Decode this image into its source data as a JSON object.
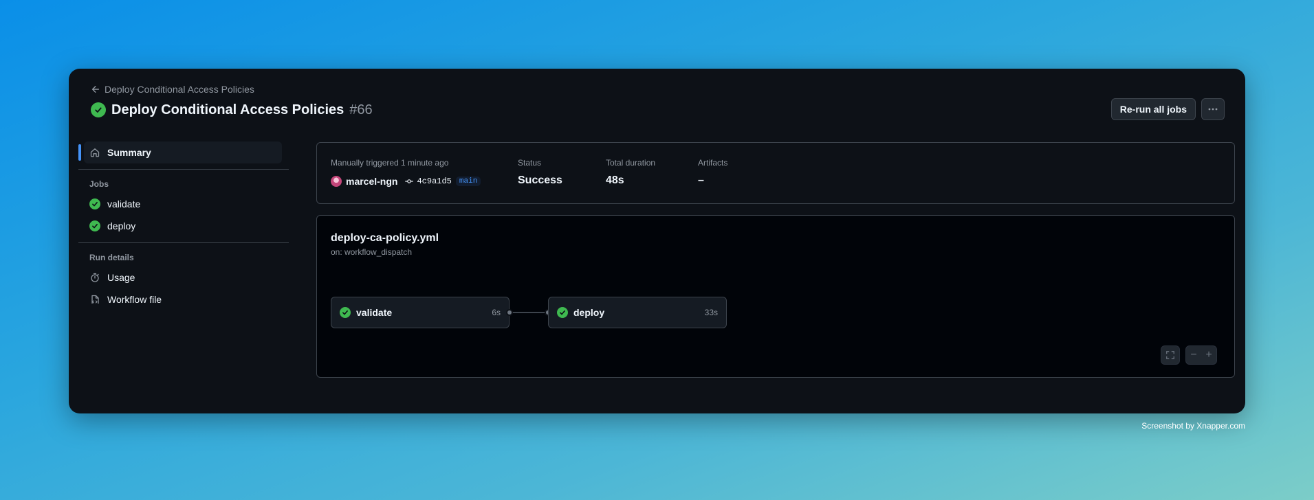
{
  "header": {
    "back_label": "Deploy Conditional Access Policies",
    "title": "Deploy Conditional Access Policies",
    "run_number": "#66",
    "rerun_label": "Re-run all jobs",
    "more_icon": "kebab-horizontal-icon"
  },
  "sidebar": {
    "summary_label": "Summary",
    "jobs_heading": "Jobs",
    "jobs": [
      {
        "label": "validate",
        "status": "success"
      },
      {
        "label": "deploy",
        "status": "success"
      }
    ],
    "run_details_heading": "Run details",
    "details": [
      {
        "label": "Usage",
        "icon": "stopwatch-icon"
      },
      {
        "label": "Workflow file",
        "icon": "file-code-icon"
      }
    ]
  },
  "summary": {
    "trigger_label": "Manually triggered 1 minute ago",
    "actor": "marcel-ngn",
    "commit_sha": "4c9a1d5",
    "branch": "main",
    "status_label": "Status",
    "status_value": "Success",
    "duration_label": "Total duration",
    "duration_value": "48s",
    "artifacts_label": "Artifacts",
    "artifacts_value": "–"
  },
  "graph": {
    "workflow_file": "deploy-ca-policy.yml",
    "trigger": "on: workflow_dispatch",
    "jobs": [
      {
        "name": "validate",
        "duration": "6s"
      },
      {
        "name": "deploy",
        "duration": "33s"
      }
    ]
  },
  "footer": {
    "credit": "Screenshot by Xnapper.com"
  },
  "colors": {
    "success": "#3fb950",
    "accent": "#4493f8",
    "background": "#0d1117"
  }
}
